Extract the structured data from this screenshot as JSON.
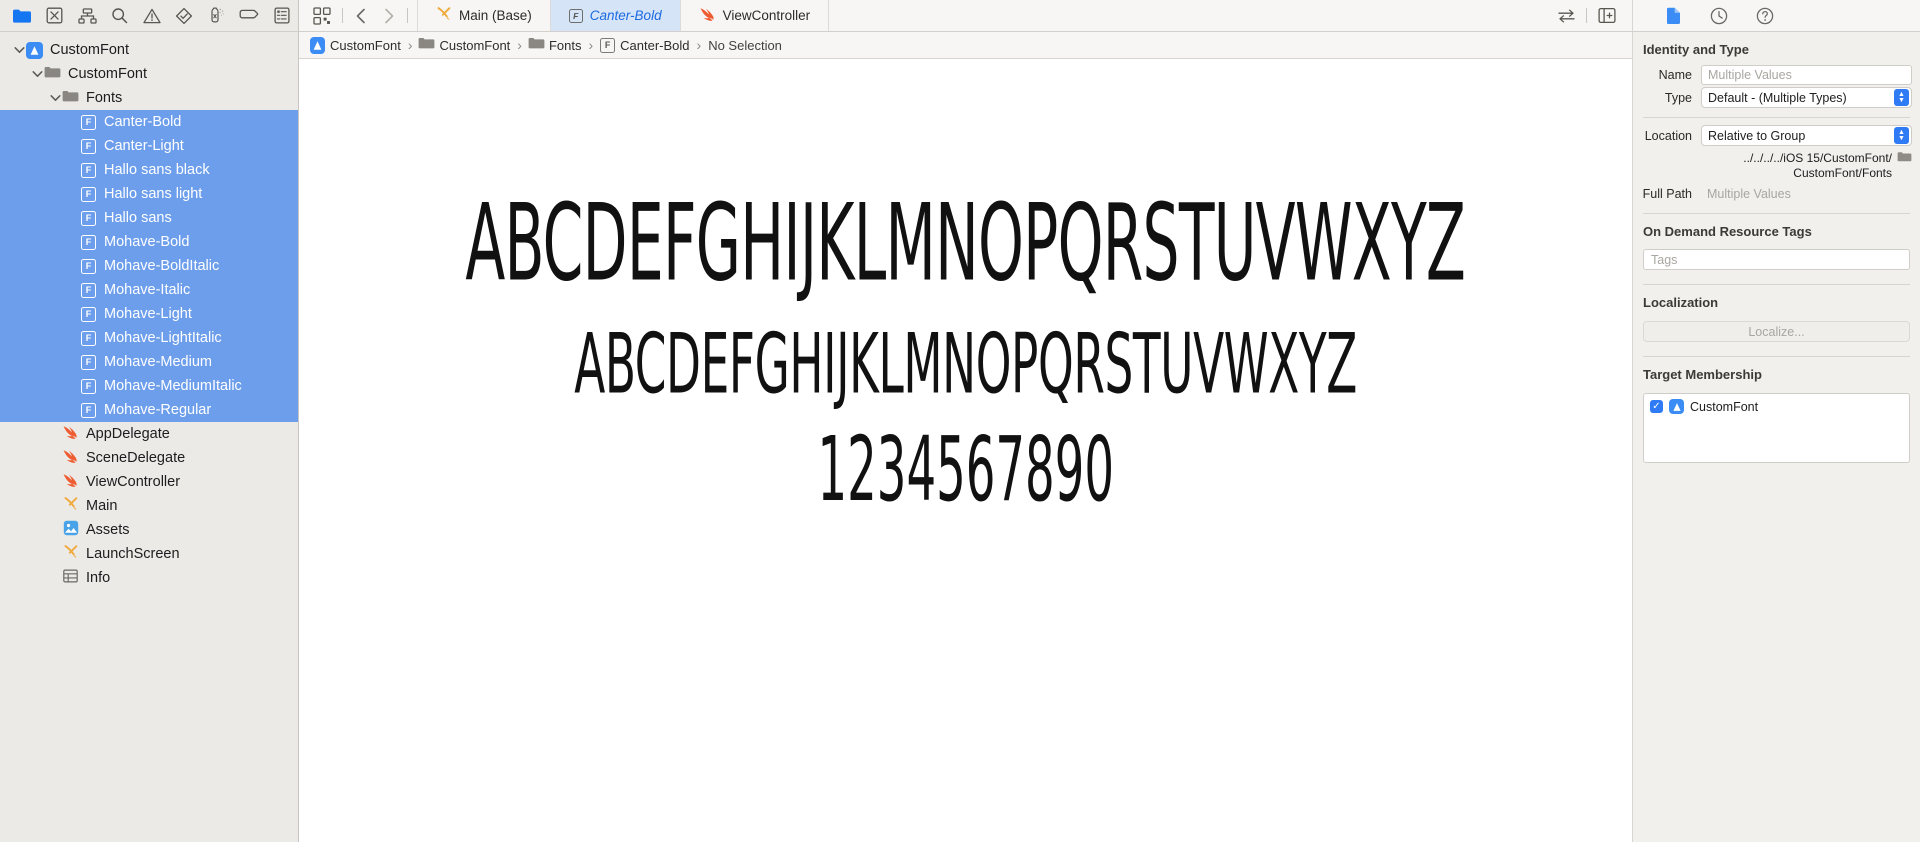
{
  "toolbar": {
    "navigator_buttons": [
      {
        "name": "project-navigator",
        "icon": "folder-icon",
        "active": true
      },
      {
        "name": "source-control-navigator",
        "icon": "source-control-icon",
        "active": false
      },
      {
        "name": "symbol-navigator",
        "icon": "hierarchy-icon",
        "active": false
      },
      {
        "name": "find-navigator",
        "icon": "search-icon",
        "active": false
      },
      {
        "name": "issue-navigator",
        "icon": "warning-icon",
        "active": false
      },
      {
        "name": "test-navigator",
        "icon": "diamond-icon",
        "active": false
      },
      {
        "name": "debug-navigator",
        "icon": "spray-icon",
        "active": false
      },
      {
        "name": "breakpoint-navigator",
        "icon": "breakpoint-icon",
        "active": false
      },
      {
        "name": "report-navigator",
        "icon": "report-icon",
        "active": false
      }
    ],
    "editor_options_icon": "grid-options-icon",
    "back_icon": "chevron-left-icon",
    "forward_icon": "chevron-right-icon",
    "swap_icon": "swap-arrows-icon",
    "add_editor_icon": "add-editor-icon",
    "inspector_tabs": [
      {
        "name": "file-inspector",
        "icon": "document-icon",
        "active": true
      },
      {
        "name": "history-inspector",
        "icon": "clock-icon",
        "active": false
      },
      {
        "name": "quick-help-inspector",
        "icon": "help-icon",
        "active": false
      }
    ]
  },
  "tabs": [
    {
      "label": "Main (Base)",
      "icon": "interface-builder-icon",
      "active": false
    },
    {
      "label": "Canter-Bold",
      "icon": "font-file-icon",
      "active": true
    },
    {
      "label": "ViewController",
      "icon": "swift-icon",
      "active": false
    }
  ],
  "sidebar": {
    "items": [
      {
        "label": "CustomFont",
        "icon": "app-project-icon",
        "indent": 0,
        "twisty": "down",
        "selected": false
      },
      {
        "label": "CustomFont",
        "icon": "folder-icon",
        "indent": 1,
        "twisty": "down",
        "selected": false
      },
      {
        "label": "Fonts",
        "icon": "folder-icon",
        "indent": 2,
        "twisty": "down",
        "selected": false
      },
      {
        "label": "Canter-Bold",
        "icon": "font-file-icon",
        "indent": 3,
        "twisty": "none",
        "selected": true
      },
      {
        "label": "Canter-Light",
        "icon": "font-file-icon",
        "indent": 3,
        "twisty": "none",
        "selected": true
      },
      {
        "label": "Hallo sans black",
        "icon": "font-file-icon",
        "indent": 3,
        "twisty": "none",
        "selected": true
      },
      {
        "label": "Hallo sans light",
        "icon": "font-file-icon",
        "indent": 3,
        "twisty": "none",
        "selected": true
      },
      {
        "label": "Hallo sans",
        "icon": "font-file-icon",
        "indent": 3,
        "twisty": "none",
        "selected": true
      },
      {
        "label": "Mohave-Bold",
        "icon": "font-file-icon",
        "indent": 3,
        "twisty": "none",
        "selected": true
      },
      {
        "label": "Mohave-BoldItalic",
        "icon": "font-file-icon",
        "indent": 3,
        "twisty": "none",
        "selected": true
      },
      {
        "label": "Mohave-Italic",
        "icon": "font-file-icon",
        "indent": 3,
        "twisty": "none",
        "selected": true
      },
      {
        "label": "Mohave-Light",
        "icon": "font-file-icon",
        "indent": 3,
        "twisty": "none",
        "selected": true
      },
      {
        "label": "Mohave-LightItalic",
        "icon": "font-file-icon",
        "indent": 3,
        "twisty": "none",
        "selected": true
      },
      {
        "label": "Mohave-Medium",
        "icon": "font-file-icon",
        "indent": 3,
        "twisty": "none",
        "selected": true
      },
      {
        "label": "Mohave-MediumItalic",
        "icon": "font-file-icon",
        "indent": 3,
        "twisty": "none",
        "selected": true
      },
      {
        "label": "Mohave-Regular",
        "icon": "font-file-icon",
        "indent": 3,
        "twisty": "none",
        "selected": true
      },
      {
        "label": "AppDelegate",
        "icon": "swift-icon",
        "indent": 2,
        "twisty": "none",
        "selected": false
      },
      {
        "label": "SceneDelegate",
        "icon": "swift-icon",
        "indent": 2,
        "twisty": "none",
        "selected": false
      },
      {
        "label": "ViewController",
        "icon": "swift-icon",
        "indent": 2,
        "twisty": "none",
        "selected": false
      },
      {
        "label": "Main",
        "icon": "interface-builder-icon",
        "indent": 2,
        "twisty": "none",
        "selected": false
      },
      {
        "label": "Assets",
        "icon": "assets-icon",
        "indent": 2,
        "twisty": "none",
        "selected": false
      },
      {
        "label": "LaunchScreen",
        "icon": "interface-builder-icon",
        "indent": 2,
        "twisty": "none",
        "selected": false
      },
      {
        "label": "Info",
        "icon": "plist-icon",
        "indent": 2,
        "twisty": "none",
        "selected": false
      }
    ]
  },
  "breadcrumb": {
    "items": [
      {
        "label": "CustomFont",
        "icon": "app-project-icon"
      },
      {
        "label": "CustomFont",
        "icon": "folder-icon"
      },
      {
        "label": "Fonts",
        "icon": "folder-icon"
      },
      {
        "label": "Canter-Bold",
        "icon": "font-file-icon"
      },
      {
        "label": "No Selection",
        "icon": "none"
      }
    ],
    "separator": "›"
  },
  "font_preview": {
    "uppercase_large": "ABCDEFGHIJKLMNOPQRSTUVWXYZ",
    "uppercase_medium": "ABCDEFGHIJKLMNOPQRSTUVWXYZ",
    "digits": "1234567890"
  },
  "inspector": {
    "identity": {
      "title": "Identity and Type",
      "name_label": "Name",
      "name_placeholder": "Multiple Values",
      "name_value": "",
      "type_label": "Type",
      "type_value": "Default - (Multiple Types)",
      "location_label": "Location",
      "location_value": "Relative to Group",
      "path_line1": "../../../../iOS 15/CustomFont/",
      "path_line2": "CustomFont/Fonts",
      "full_path_label": "Full Path",
      "full_path_value": "Multiple Values"
    },
    "odr": {
      "title": "On Demand Resource Tags",
      "tags_placeholder": "Tags",
      "tags_value": ""
    },
    "localization": {
      "title": "Localization",
      "button_label": "Localize..."
    },
    "target_membership": {
      "title": "Target Membership",
      "targets": [
        {
          "label": "CustomFont",
          "checked": true,
          "icon": "app-project-icon"
        }
      ]
    }
  },
  "colors": {
    "selection_blue": "#6d9eeb",
    "accent_blue": "#2f7bf6",
    "tab_active_bg": "#d6e4f7",
    "tab_active_text": "#1a6ae0",
    "swift_orange": "#ef5c31",
    "ib_yellow": "#f0a93b",
    "sidebar_bg": "#eceae6"
  }
}
